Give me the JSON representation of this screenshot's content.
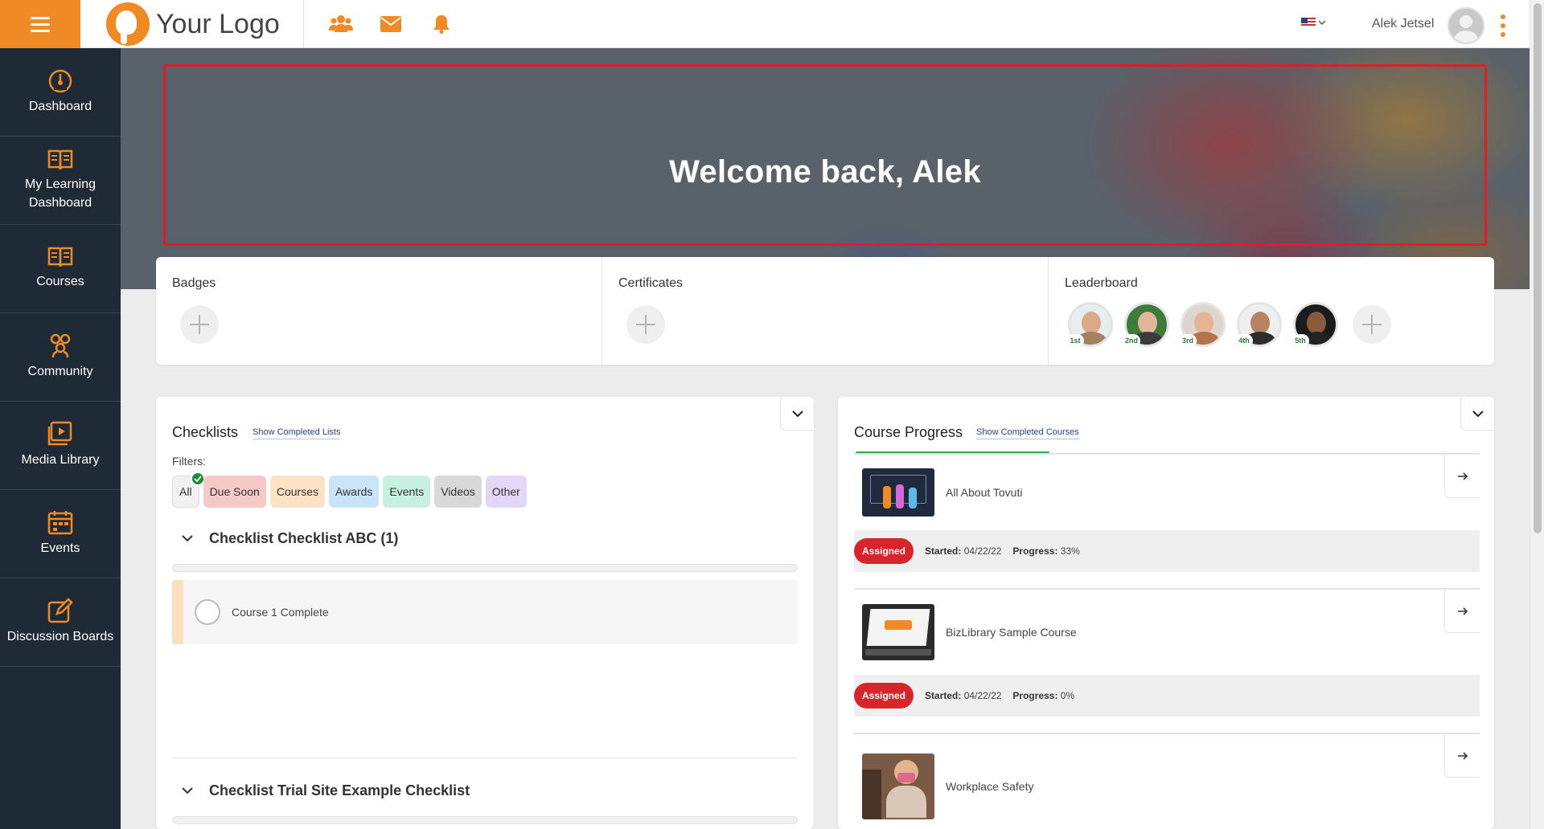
{
  "topbar": {
    "logo_text": "Your Logo",
    "user_name": "Alek Jetsel",
    "icons": [
      "users-icon",
      "mail-icon",
      "bell-icon"
    ],
    "language": "en-US"
  },
  "sidebar": {
    "items": [
      {
        "label": "Dashboard",
        "icon": "dashboard-gauge-icon"
      },
      {
        "label": "My Learning Dashboard",
        "icon": "open-book-icon"
      },
      {
        "label": "Courses",
        "icon": "book-icon"
      },
      {
        "label": "Community",
        "icon": "community-icon"
      },
      {
        "label": "Media Library",
        "icon": "media-library-icon"
      },
      {
        "label": "Events",
        "icon": "calendar-icon"
      },
      {
        "label": "Discussion Boards",
        "icon": "discussion-pen-icon"
      }
    ]
  },
  "hero": {
    "title": "Welcome back, Alek"
  },
  "achievements": {
    "badges_title": "Badges",
    "certificates_title": "Certificates",
    "leaderboard_title": "Leaderboard",
    "leaders": [
      {
        "rank": "1st"
      },
      {
        "rank": "2nd"
      },
      {
        "rank": "3rd"
      },
      {
        "rank": "4th"
      },
      {
        "rank": "5th"
      }
    ]
  },
  "checklists": {
    "title": "Checklists",
    "show_completed": "Show Completed Lists",
    "filters_label": "Filters:",
    "filters": [
      {
        "label": "All",
        "color": "#f1f1f1"
      },
      {
        "label": "Due Soon",
        "color": "#f6c9c9"
      },
      {
        "label": "Courses",
        "color": "#fde3c5"
      },
      {
        "label": "Awards",
        "color": "#c8e4f6"
      },
      {
        "label": "Events",
        "color": "#c8f0e0"
      },
      {
        "label": "Videos",
        "color": "#d9d9d9"
      },
      {
        "label": "Other",
        "color": "#e3d6f6"
      }
    ],
    "groups": [
      {
        "title": "Checklist Checklist ABC (1)",
        "items": [
          "Course 1 Complete"
        ]
      },
      {
        "title": "Checklist Trial Site Example Checklist",
        "items": []
      }
    ]
  },
  "course_progress": {
    "title": "Course Progress",
    "show_completed": "Show Completed Courses",
    "overall_progress": 0.31,
    "courses": [
      {
        "name": "All About Tovuti",
        "status": "Assigned",
        "started_label": "Started:",
        "started": "04/22/22",
        "progress_label": "Progress:",
        "progress": "33%"
      },
      {
        "name": "BizLibrary Sample Course",
        "status": "Assigned",
        "started_label": "Started:",
        "started": "04/22/22",
        "progress_label": "Progress:",
        "progress": "0%"
      },
      {
        "name": "Workplace Safety"
      }
    ]
  },
  "colors": {
    "accent": "#ef8a24",
    "sidebar_bg": "#1e2b36",
    "assigned_red": "#d8242b",
    "progress_green": "#33a852"
  }
}
